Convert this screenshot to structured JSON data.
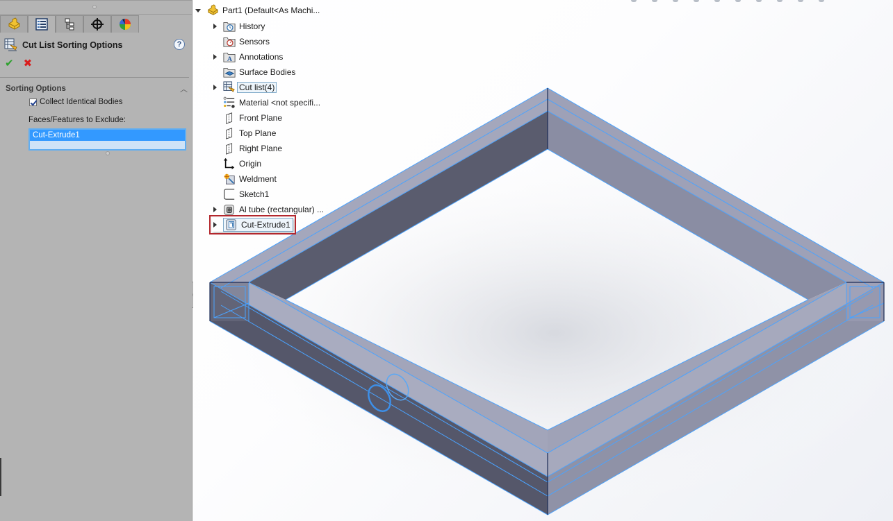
{
  "property_manager": {
    "tabs": [
      {
        "name": "feature-manager",
        "icon": "part-icon",
        "active": false
      },
      {
        "name": "property-manager",
        "icon": "property-manager-icon",
        "active": true
      },
      {
        "name": "configuration-manager",
        "icon": "configuration-icon",
        "active": false
      },
      {
        "name": "dimxpert-manager",
        "icon": "crosshair-icon",
        "active": false
      },
      {
        "name": "display-manager",
        "icon": "appearance-icon",
        "active": false
      }
    ],
    "title": "Cut List Sorting Options",
    "help_label": "?",
    "ok_label": "✔",
    "cancel_label": "✖",
    "group": {
      "label": "Sorting Options",
      "collapse_icon": "︿",
      "collect_identical_bodies": {
        "label": "Collect Identical Bodies",
        "checked": true
      },
      "exclude_label": "Faces/Features to Exclude:",
      "exclude_items": [
        "Cut-Extrude1"
      ]
    }
  },
  "feature_tree": {
    "root": {
      "label": "Part1  (Default<As Machi...",
      "expanded": true
    },
    "items": [
      {
        "label": "History",
        "icon": "history-folder-icon",
        "expandable": true
      },
      {
        "label": "Sensors",
        "icon": "sensors-folder-icon",
        "expandable": false
      },
      {
        "label": "Annotations",
        "icon": "annotations-folder-icon",
        "expandable": true
      },
      {
        "label": "Surface Bodies",
        "icon": "surface-bodies-folder-icon",
        "expandable": false
      },
      {
        "label": "Cut list(4)",
        "icon": "cut-list-icon",
        "expandable": true,
        "selected": true
      },
      {
        "label": "Material <not specifi...",
        "icon": "material-icon",
        "expandable": false
      },
      {
        "label": "Front Plane",
        "icon": "plane-icon",
        "expandable": false
      },
      {
        "label": "Top Plane",
        "icon": "plane-icon",
        "expandable": false
      },
      {
        "label": "Right Plane",
        "icon": "plane-icon",
        "expandable": false
      },
      {
        "label": "Origin",
        "icon": "origin-icon",
        "expandable": false
      },
      {
        "label": "Weldment",
        "icon": "weldment-icon",
        "expandable": false
      },
      {
        "label": "Sketch1",
        "icon": "sketch-icon",
        "expandable": false
      },
      {
        "label": "Al tube (rectangular) ...",
        "icon": "structural-member-icon",
        "expandable": true
      },
      {
        "label": "Cut-Extrude1",
        "icon": "cut-extrude-icon",
        "expandable": true,
        "highlighted": true
      }
    ]
  },
  "colors": {
    "panel_bg": "#b4b4b4",
    "selection_blue": "#3399ff",
    "highlight_red": "#b3272d",
    "edge_blue": "#4aa3ff",
    "face_top": "#9fa3b8",
    "face_dark": "#55576a"
  }
}
